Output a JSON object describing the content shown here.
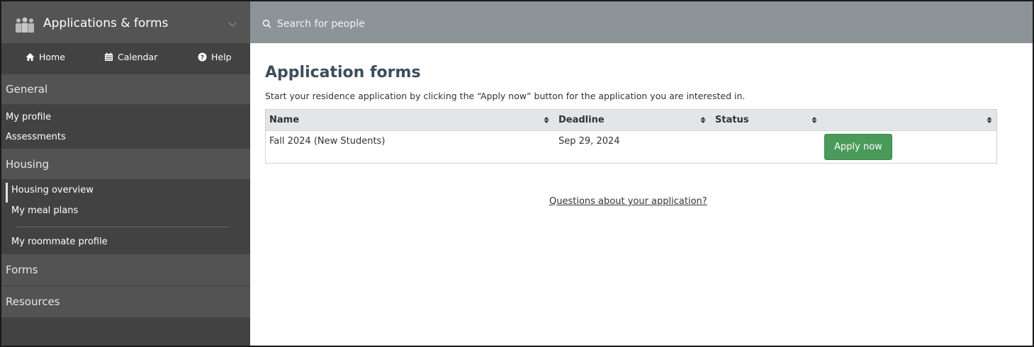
{
  "sidebar": {
    "app_title": "Applications & forms",
    "nav": [
      {
        "label": "Home",
        "icon": "home-icon"
      },
      {
        "label": "Calendar",
        "icon": "calendar-icon"
      },
      {
        "label": "Help",
        "icon": "help-icon"
      }
    ],
    "sections": {
      "general": "General",
      "housing": "Housing",
      "forms": "Forms",
      "resources": "Resources"
    },
    "general_links": [
      "My profile",
      "Assessments"
    ],
    "housing_links": [
      "Housing overview",
      "My meal plans",
      "My roommate profile"
    ],
    "selected_item": "Housing overview"
  },
  "search": {
    "placeholder": "Search for people"
  },
  "main": {
    "title": "Application forms",
    "intro": "Start your residence application by clicking the “Apply now” button for the application you are interested in.",
    "table": {
      "columns": [
        "Name",
        "Deadline",
        "Status",
        ""
      ],
      "rows": [
        {
          "name": "Fall 2024 (New Students)",
          "deadline": "Sep 29, 2024",
          "status": "",
          "action": "Apply now"
        }
      ]
    },
    "questions_link": "Questions about your application?"
  },
  "colors": {
    "sidebar_bg": "#424242",
    "sidebar_section_bg": "#535353",
    "searchbar_bg": "#8c9498",
    "title_color": "#3c4d5c",
    "apply_button": "#4a9a5a"
  }
}
